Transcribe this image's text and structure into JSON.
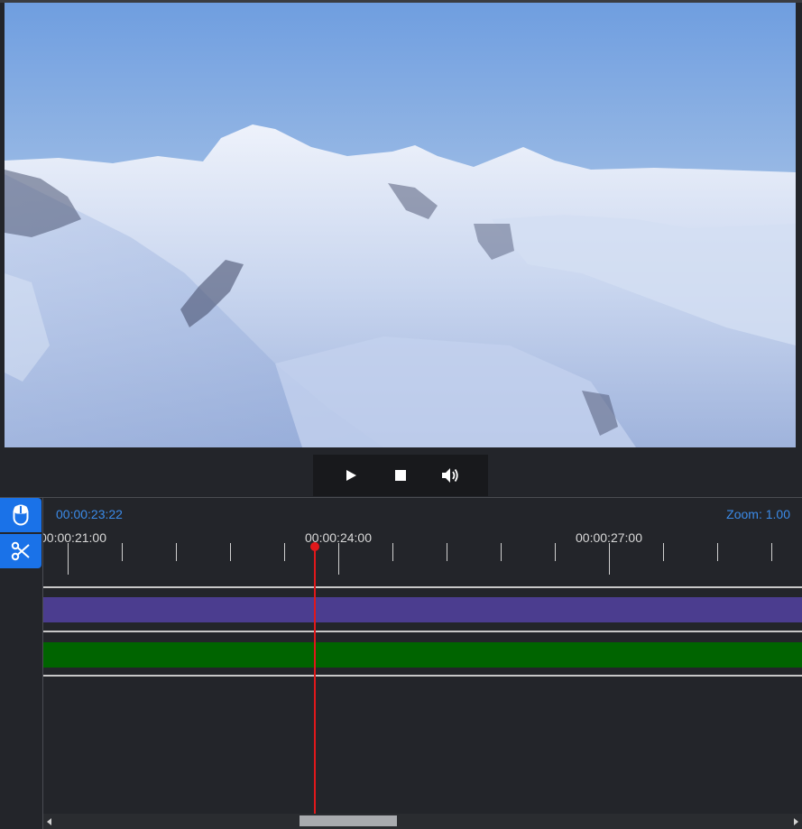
{
  "video": {
    "description_icon": "snowy-mountains-frame"
  },
  "controls": {
    "play_icon": "play-icon",
    "stop_icon": "stop-icon",
    "volume_icon": "volume-icon"
  },
  "tools": {
    "select_icon": "mouse-icon",
    "cut_icon": "scissors-icon"
  },
  "timeline": {
    "current_time": "00:00:23:22",
    "zoom_label": "Zoom: 1.00",
    "ruler_labels": [
      "00:00:21:00",
      "00:00:24:00",
      "00:00:27:00"
    ]
  },
  "colors": {
    "accent": "#1a72e8",
    "playhead": "#e0181b",
    "video_clip": "#4b3d8f",
    "audio_clip": "#006400"
  }
}
